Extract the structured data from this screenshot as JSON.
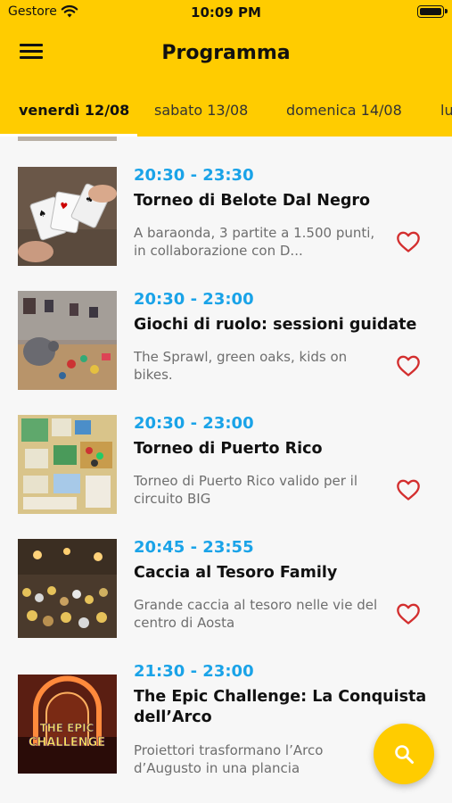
{
  "status_bar": {
    "carrier": "Gestore",
    "time": "10:09 PM"
  },
  "header": {
    "title": "Programma"
  },
  "tabs": [
    {
      "label": "venerdì 12/08",
      "active": true
    },
    {
      "label": "sabato 13/08",
      "active": false
    },
    {
      "label": "domenica 14/08",
      "active": false
    },
    {
      "label": "lu",
      "active": false
    }
  ],
  "events": [
    {
      "time": "20:30 - 23:30",
      "name": "Torneo di Belote Dal Negro",
      "description": "A baraonda, 3 partite a 1.500 punti, in collaborazione con D...",
      "favorite": false
    },
    {
      "time": "20:30 - 23:00",
      "name": "Giochi di ruolo: sessioni guidate",
      "description": "The Sprawl, green oaks, kids on bikes.",
      "favorite": false
    },
    {
      "time": "20:30 - 23:00",
      "name": "Torneo di Puerto Rico",
      "description": "Torneo di Puerto Rico valido per il circuito BIG",
      "favorite": false
    },
    {
      "time": "20:45 - 23:55",
      "name": "Caccia al Tesoro Family",
      "description": "Grande caccia al tesoro nelle vie del centro di Aosta",
      "favorite": false
    },
    {
      "time": "21:30 - 23:00",
      "name": "The Epic Challenge: La Conquista dell’Arco",
      "description": "Proiettori trasformano l’Arco d’Augusto in una plancia",
      "favorite": false
    }
  ],
  "event_images": {
    "epic_line1": "THE EPIC",
    "epic_line2": "CHALLENGE"
  },
  "icons": {
    "menu": "menu-icon",
    "favorite": "heart-outline-icon",
    "search": "search-icon"
  },
  "colors": {
    "accent": "#ffcc00",
    "time": "#1aa3e8",
    "heart": "#d32f2f"
  }
}
